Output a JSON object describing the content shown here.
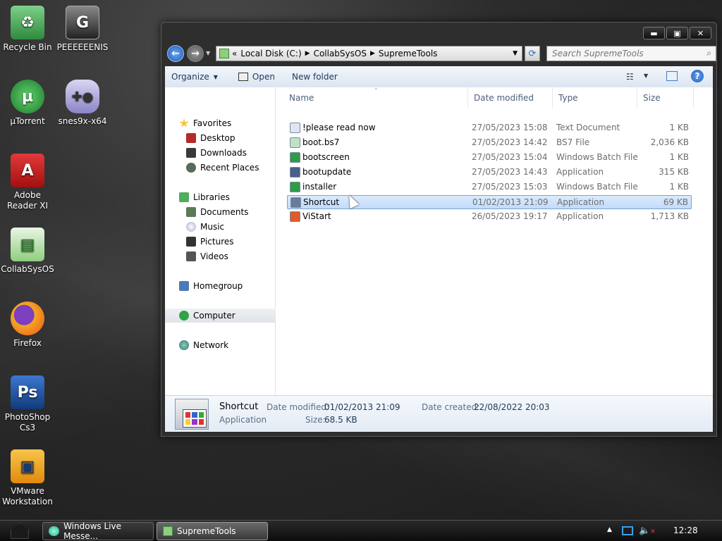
{
  "desktop": {
    "icons": [
      {
        "label": "Recycle Bin",
        "icon": "recycle-bin-icon",
        "color": "#3aa845"
      },
      {
        "label": "PEEEEEENIS",
        "icon": "app-g-icon",
        "color": "#444444"
      },
      {
        "label": "µTorrent",
        "icon": "utorrent-icon",
        "color": "#2f9b3e"
      },
      {
        "label": "snes9x-x64",
        "icon": "gamepad-icon",
        "color": "#9a8fd6"
      },
      {
        "label": "Adobe Reader XI",
        "icon": "adobe-reader-icon",
        "color": "#d71b1b"
      },
      {
        "label": "CollabSysOS",
        "icon": "folder-icon",
        "color": "#6cbf5b"
      },
      {
        "label": "Firefox",
        "icon": "firefox-icon",
        "color": "#e8641e"
      },
      {
        "label": "PhotoShop Cs3",
        "icon": "photoshop-icon",
        "color": "#1d4f9c"
      },
      {
        "label": "VMware Workstation",
        "icon": "vmware-icon",
        "color": "#f0a818"
      }
    ]
  },
  "window": {
    "controls": {
      "minimize": "▬",
      "maximize": "▣",
      "close": "✕"
    },
    "address": {
      "prefix": "«",
      "crumbs": [
        "Local Disk (C:)",
        "CollabSysOS",
        "SupremeTools"
      ]
    },
    "search": {
      "placeholder": "Search SupremeTools"
    },
    "toolbar": {
      "organize": "Organize",
      "open": "Open",
      "new_folder": "New folder"
    },
    "nav": {
      "favorites": "Favorites",
      "desktop": "Desktop",
      "downloads": "Downloads",
      "recent_places": "Recent Places",
      "libraries": "Libraries",
      "documents": "Documents",
      "music": "Music",
      "pictures": "Pictures",
      "videos": "Videos",
      "homegroup": "Homegroup",
      "computer": "Computer",
      "network": "Network"
    },
    "columns": {
      "name": "Name",
      "date_modified": "Date modified",
      "type": "Type",
      "size": "Size"
    },
    "files": [
      {
        "name": "!please read now",
        "date": "27/05/2023 15:08",
        "type": "Text Document",
        "size": "1 KB",
        "icon": "text-file-icon",
        "color": "#dfe6ef"
      },
      {
        "name": "boot.bs7",
        "date": "27/05/2023 14:42",
        "type": "BS7 File",
        "size": "2,036 KB",
        "icon": "generic-file-icon",
        "color": "#bfe3c4"
      },
      {
        "name": "bootscreen",
        "date": "27/05/2023 15:04",
        "type": "Windows Batch File",
        "size": "1 KB",
        "icon": "batch-file-icon",
        "color": "#2e9b46"
      },
      {
        "name": "bootupdate",
        "date": "27/05/2023 14:43",
        "type": "Application",
        "size": "315 KB",
        "icon": "update-app-icon",
        "color": "#4a5f8a"
      },
      {
        "name": "installer",
        "date": "27/05/2023 15:03",
        "type": "Windows Batch File",
        "size": "1 KB",
        "icon": "batch-file-icon",
        "color": "#2e9b46"
      },
      {
        "name": "Shortcut",
        "date": "01/02/2013 21:09",
        "type": "Application",
        "size": "69 KB",
        "icon": "shortcut-app-icon",
        "color": "#6a7a99"
      },
      {
        "name": "ViStart",
        "date": "26/05/2023 19:17",
        "type": "Application",
        "size": "1,713 KB",
        "icon": "vistart-icon",
        "color": "#e05a2a"
      }
    ],
    "selected_file": "Shortcut",
    "details": {
      "name": "Shortcut",
      "type": "Application",
      "date_modified_label": "Date modified:",
      "date_modified": "01/02/2013 21:09",
      "date_created_label": "Date created:",
      "date_created": "22/08/2022 20:03",
      "size_label": "Size:",
      "size": "68.5 KB"
    }
  },
  "taskbar": {
    "buttons": [
      {
        "label": "Windows Live Messe...",
        "icon": "messenger-icon"
      },
      {
        "label": "SupremeTools",
        "icon": "folder-icon"
      }
    ],
    "clock": "12:28"
  },
  "colors": {
    "accent": "#1e395b",
    "selection": "#c1dbfc"
  }
}
